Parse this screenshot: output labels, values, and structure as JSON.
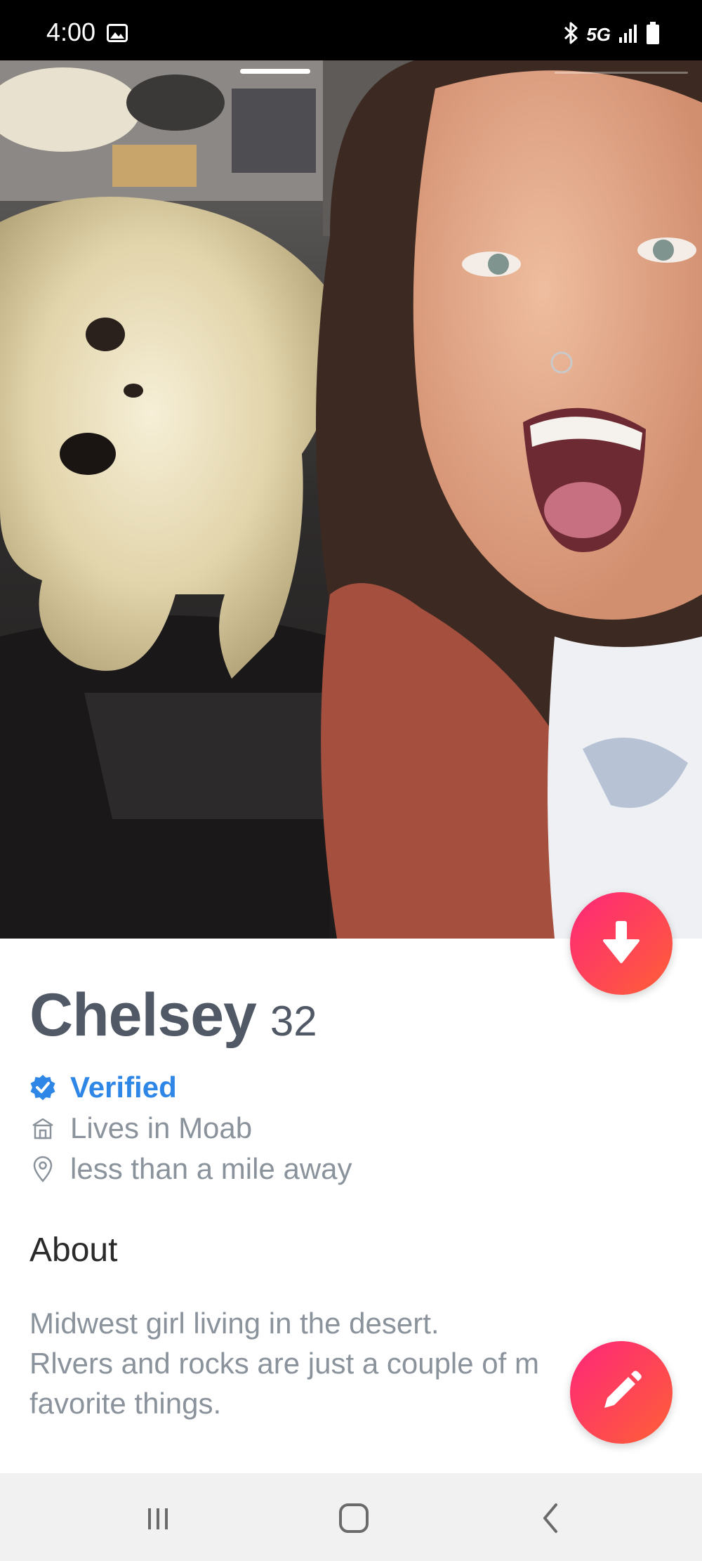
{
  "status_bar": {
    "time": "4:00",
    "network": "5G",
    "icons": [
      "image-icon",
      "bluetooth-icon",
      "signal-icon",
      "battery-icon"
    ]
  },
  "photo": {
    "description_icon": "profile-photo",
    "active_index": 1
  },
  "profile": {
    "name": "Chelsey",
    "age": "32",
    "verified_label": "Verified",
    "lives_in": "Lives in Moab",
    "distance": "less than a mile away"
  },
  "about": {
    "title": "About",
    "body": "Midwest girl living in the desert.\nRlvers and rocks are just a couple of m\nfavorite things."
  },
  "colors": {
    "accent_gradient_start": "#fd267a",
    "accent_gradient_end": "#ff6036",
    "verified_blue": "#2e86e6",
    "text_gray": "#8a929b",
    "name_gray": "#505965"
  },
  "nav": {
    "icons": [
      "recents-icon",
      "home-icon",
      "back-icon"
    ]
  }
}
